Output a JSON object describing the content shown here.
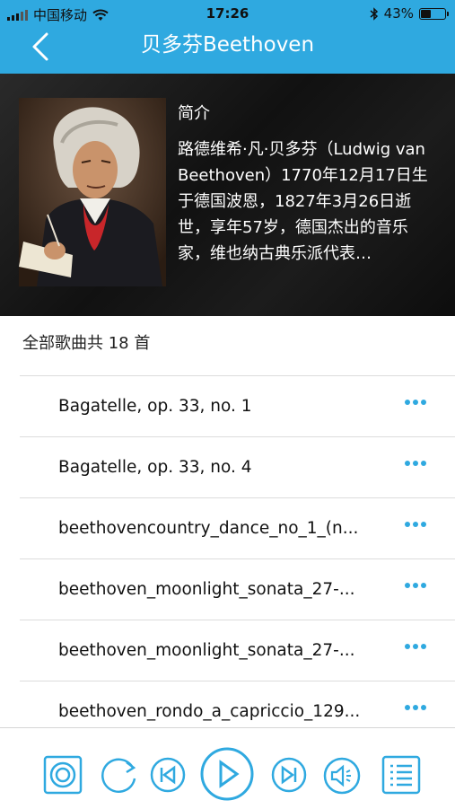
{
  "status_bar": {
    "carrier": "中国移动",
    "time": "17:26",
    "battery": "43%",
    "battery_level": 0.43
  },
  "header": {
    "title": "贝多芬Beethoven"
  },
  "intro": {
    "label": "简介",
    "text": "路德维希·凡·贝多芬（Ludwig van Beethoven）1770年12月17日生于德国波恩，1827年3月26日逝世，享年57岁，德国杰出的音乐家，维也纳古典乐派代表…"
  },
  "song_count_label": "全部歌曲共 18 首",
  "songs": [
    {
      "title": "Bagatelle, op. 33, no. 1"
    },
    {
      "title": "Bagatelle, op. 33, no. 4"
    },
    {
      "title": "beethovencountry_dance_no_1_(n..."
    },
    {
      "title": "beethoven_moonlight_sonata_27-..."
    },
    {
      "title": "beethoven_moonlight_sonata_27-..."
    },
    {
      "title": "beethoven_rondo_a_capriccio_129..."
    }
  ],
  "player": {
    "buttons": [
      "record-icon",
      "repeat-icon",
      "previous-icon",
      "play-icon",
      "next-icon",
      "volume-icon",
      "playlist-icon"
    ]
  },
  "colors": {
    "accent": "#2fa9e0"
  }
}
